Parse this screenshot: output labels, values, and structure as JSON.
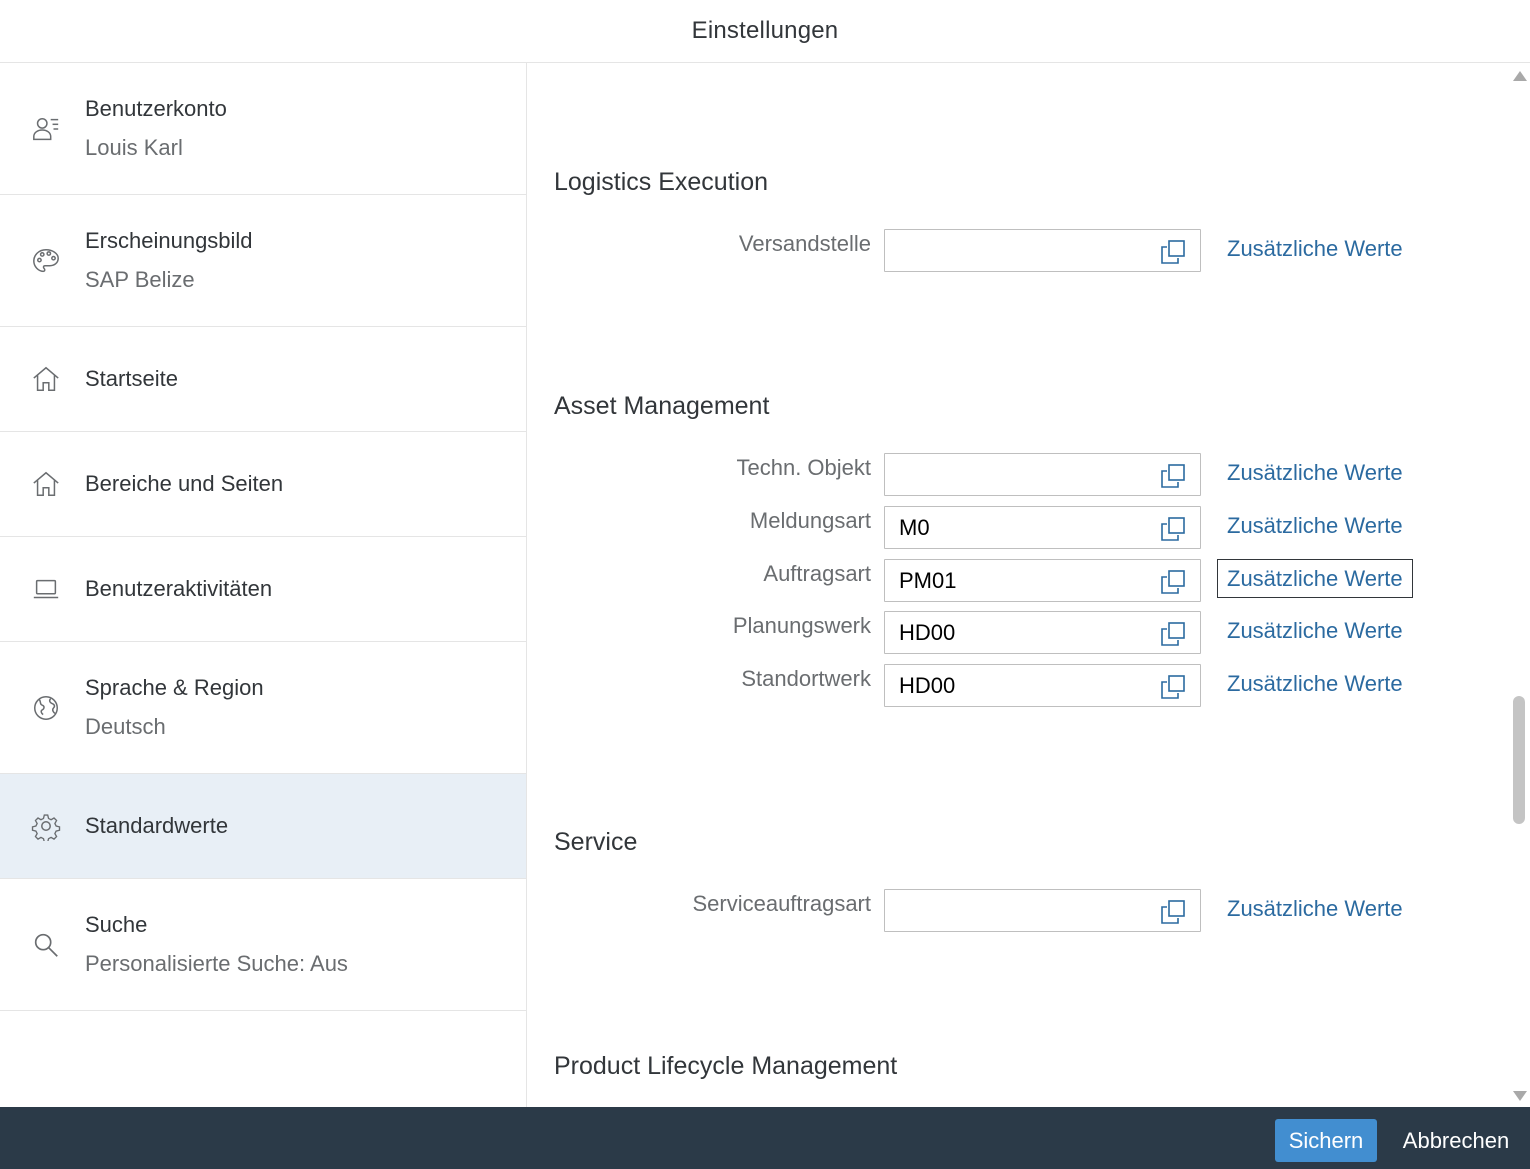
{
  "header": {
    "title": "Einstellungen"
  },
  "sidebar": {
    "items": [
      {
        "title": "Benutzerkonto",
        "subtitle": "Louis Karl",
        "icon": "user-settings-icon"
      },
      {
        "title": "Erscheinungsbild",
        "subtitle": "SAP Belize",
        "icon": "palette-icon"
      },
      {
        "title": "Startseite",
        "subtitle": "",
        "icon": "home-icon"
      },
      {
        "title": "Bereiche und Seiten",
        "subtitle": "",
        "icon": "home-icon"
      },
      {
        "title": "Benutzeraktivitäten",
        "subtitle": "",
        "icon": "laptop-icon"
      },
      {
        "title": "Sprache & Region",
        "subtitle": "Deutsch",
        "icon": "globe-icon"
      },
      {
        "title": "Standardwerte",
        "subtitle": "",
        "icon": "gear-icon",
        "selected": true
      },
      {
        "title": "Suche",
        "subtitle": "Personalisierte Suche: Aus",
        "icon": "search-icon"
      }
    ]
  },
  "content": {
    "link_label": "Zusätzliche Werte",
    "sections": [
      {
        "title": "Logistics Execution",
        "fields": [
          {
            "label": "Versandstelle",
            "value": ""
          }
        ]
      },
      {
        "title": "Asset Management",
        "fields": [
          {
            "label": "Techn. Objekt",
            "value": ""
          },
          {
            "label": "Meldungsart",
            "value": "M0"
          },
          {
            "label": "Auftragsart",
            "value": "PM01"
          },
          {
            "label": "Planungswerk",
            "value": "HD00"
          },
          {
            "label": "Standortwerk",
            "value": "HD00"
          }
        ]
      },
      {
        "title": "Service",
        "fields": [
          {
            "label": "Serviceauftragsart",
            "value": ""
          }
        ]
      },
      {
        "title": "Product Lifecycle Management",
        "fields": []
      }
    ]
  },
  "footer": {
    "save_label": "Sichern",
    "cancel_label": "Abbrechen"
  },
  "colors": {
    "accent": "#428ed0",
    "link": "#2b6aa0",
    "footer_bg": "#2b3a48",
    "selected_bg": "#e8eff6"
  }
}
